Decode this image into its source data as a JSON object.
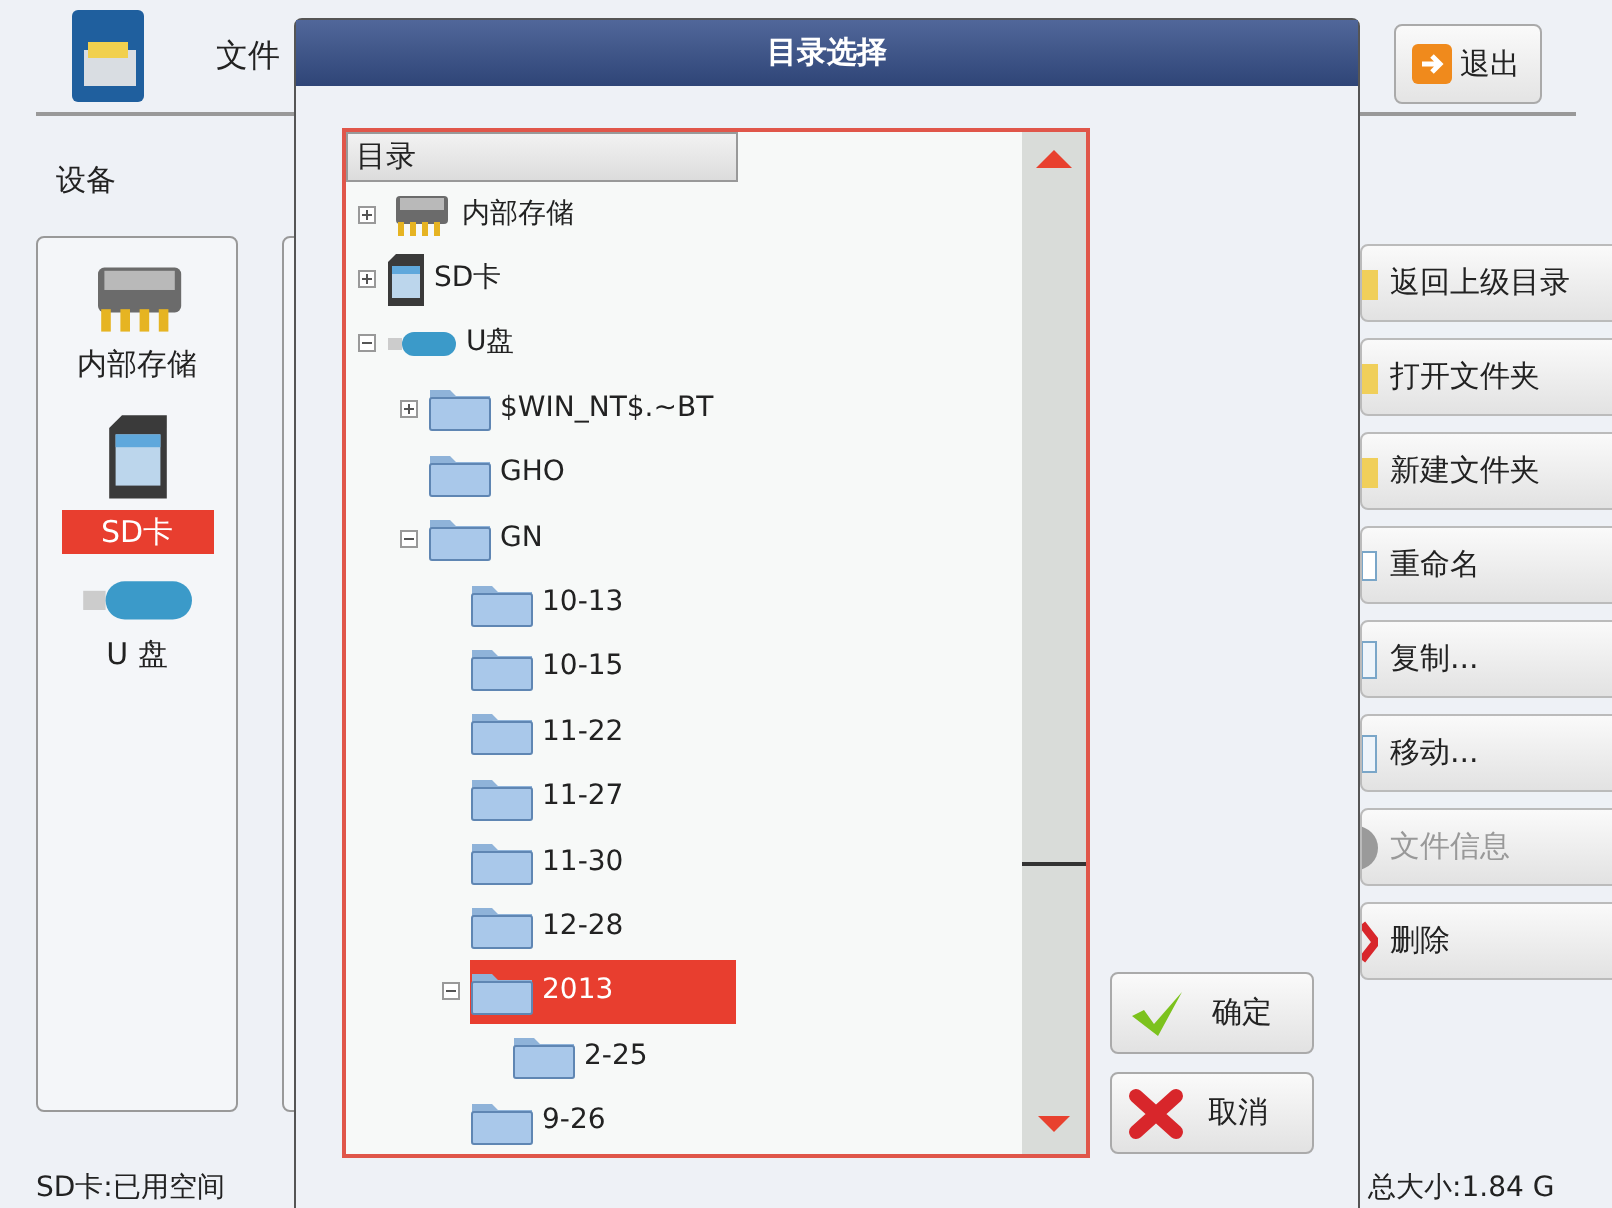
{
  "app": {
    "title": "文件",
    "section_label": "设备",
    "exit_button": "退出",
    "devices": [
      {
        "label": "内部存储",
        "kind": "chip",
        "selected": false
      },
      {
        "label": "SD卡",
        "kind": "sd",
        "selected": true
      },
      {
        "label": "U 盘",
        "kind": "usb",
        "selected": false
      }
    ],
    "actions": [
      {
        "label": "返回上级目录",
        "kind": "up",
        "disabled": false
      },
      {
        "label": "打开文件夹",
        "kind": "open",
        "disabled": false
      },
      {
        "label": "新建文件夹",
        "kind": "new",
        "disabled": false
      },
      {
        "label": "重命名",
        "kind": "rename",
        "disabled": false
      },
      {
        "label": "复制...",
        "kind": "copy",
        "disabled": false
      },
      {
        "label": "移动...",
        "kind": "move",
        "disabled": false
      },
      {
        "label": "文件信息",
        "kind": "info",
        "disabled": true
      },
      {
        "label": "删除",
        "kind": "delete",
        "disabled": false
      }
    ],
    "status_left": "SD卡:已用空间",
    "status_right": "总大小:1.84 G"
  },
  "dialog": {
    "title": "目录选择",
    "column": "目录",
    "tree": [
      {
        "label": "内部存储",
        "kind": "chip",
        "expanded": false,
        "selected": false
      },
      {
        "label": "SD卡",
        "kind": "sd",
        "expanded": false,
        "selected": false
      },
      {
        "label": "U盘",
        "kind": "usb",
        "expanded": true,
        "selected": false,
        "children": [
          {
            "label": "$WIN_NT$.~BT",
            "kind": "folder",
            "expanded": false,
            "selected": false
          },
          {
            "label": "GHO",
            "kind": "folder",
            "selected": false
          },
          {
            "label": "GN",
            "kind": "folder",
            "expanded": true,
            "selected": false,
            "children": [
              {
                "label": "10-13",
                "kind": "folder",
                "selected": false
              },
              {
                "label": "10-15",
                "kind": "folder",
                "selected": false
              },
              {
                "label": "11-22",
                "kind": "folder",
                "selected": false
              },
              {
                "label": "11-27",
                "kind": "folder",
                "selected": false
              },
              {
                "label": "11-30",
                "kind": "folder",
                "selected": false
              },
              {
                "label": "12-28",
                "kind": "folder",
                "selected": false
              },
              {
                "label": "2013",
                "kind": "folder",
                "expanded": true,
                "selected": true,
                "children": [
                  {
                    "label": "2-25",
                    "kind": "folder",
                    "selected": false
                  }
                ]
              },
              {
                "label": "9-26",
                "kind": "folder",
                "selected": false
              }
            ]
          }
        ]
      }
    ],
    "buttons": [
      {
        "label": "确定",
        "kind": "ok"
      },
      {
        "label": "取消",
        "kind": "cancel"
      }
    ]
  }
}
